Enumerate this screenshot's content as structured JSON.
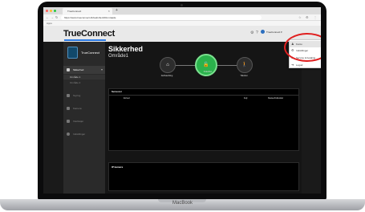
{
  "browser": {
    "tab_title": "TrueConnect",
    "new_tab": "+",
    "url": "https://www.trueconnect.dk/webclient/#/omraade",
    "bookmarks": "Apps",
    "close": "×",
    "nav": {
      "back": "←",
      "forward": "→",
      "reload": "↻"
    },
    "ext_icons": [
      "☆",
      "⚙",
      "⋮"
    ]
  },
  "app": {
    "logo": "TrueConnect",
    "header_icons": [
      "⚙",
      "?"
    ],
    "user": {
      "name": "TrueConnect",
      "caret": "▾"
    },
    "sidebar": {
      "brand": "TrueConnect",
      "items": [
        {
          "label": "Sikkerhed",
          "active": true
        },
        {
          "label": "Styring",
          "active": false
        },
        {
          "label": "Kamera",
          "active": false
        },
        {
          "label": "Værktøjer",
          "active": false
        },
        {
          "label": "Indstillinger",
          "active": false
        }
      ],
      "subitems": [
        "Område 1",
        "Område 2"
      ]
    },
    "main": {
      "title": "Sikkerhed",
      "subtitle": "Område1",
      "states": [
        {
          "label": "Delfrakobling",
          "icon": "⌂",
          "active": false
        },
        {
          "label": "Frakoblet",
          "icon": "🔓",
          "active": true
        },
        {
          "label": "Tilkoblet",
          "icon": "🚶",
          "active": false
        }
      ],
      "sensors": {
        "title": "Sensorer",
        "columns": [
          "Enhed",
          "Fejl",
          "Status/Udkoblet"
        ]
      },
      "ip_cameras": {
        "title": "IP kamera"
      }
    },
    "dropdown": {
      "items": [
        {
          "label": "Konto",
          "icon": "♟"
        },
        {
          "label": "Indstillinger",
          "icon": "⚙"
        },
        {
          "label": "Service & betaling",
          "icon": "$"
        },
        {
          "label": "Logud",
          "icon": "➜"
        }
      ]
    }
  },
  "laptop": {
    "label": "MacBook"
  },
  "colors": {
    "accent": "#2c7be5",
    "active_state": "#2bb24c",
    "annotation": "#e02020"
  }
}
